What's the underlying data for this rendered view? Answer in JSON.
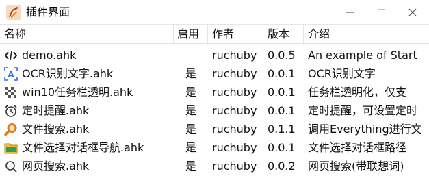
{
  "window": {
    "title": "插件界面",
    "icon": "pen-logo-icon"
  },
  "columns": {
    "name": "名称",
    "enabled": "启用",
    "author": "作者",
    "version": "版本",
    "description": "介绍"
  },
  "rows": [
    {
      "icon": "code-icon",
      "name": "demo.ahk",
      "enabled": "",
      "author": "ruchuby",
      "version": "0.0.5",
      "description": "An example of Start"
    },
    {
      "icon": "ocr-text-icon",
      "name": "OCR识别文字.ahk",
      "enabled": "是",
      "author": "ruchuby",
      "version": "0.0.1",
      "description": "OCR识别文字"
    },
    {
      "icon": "checkerboard-icon",
      "name": "win10任务栏透明.ahk",
      "enabled": "是",
      "author": "ruchuby",
      "version": "0.0.1",
      "description": "任务栏透明化，仅支"
    },
    {
      "icon": "alarm-clock-icon",
      "name": "定时提醒.ahk",
      "enabled": "是",
      "author": "ruchuby",
      "version": "0.0.1",
      "description": "定时提醒，可设置定时"
    },
    {
      "icon": "orange-search-icon",
      "name": "文件搜索.ahk",
      "enabled": "是",
      "author": "ruchuby",
      "version": "0.1.1",
      "description": "调用Everything进行文"
    },
    {
      "icon": "folder-icon",
      "name": "文件选择对话框导航.ahk",
      "enabled": "是",
      "author": "ruchuby",
      "version": "0.0.1",
      "description": "文件选择对话框路径"
    },
    {
      "icon": "search-icon",
      "name": "网页搜索.ahk",
      "enabled": "是",
      "author": "ruchuby",
      "version": "0.0.2",
      "description": "网页搜索(带联想词)"
    }
  ]
}
